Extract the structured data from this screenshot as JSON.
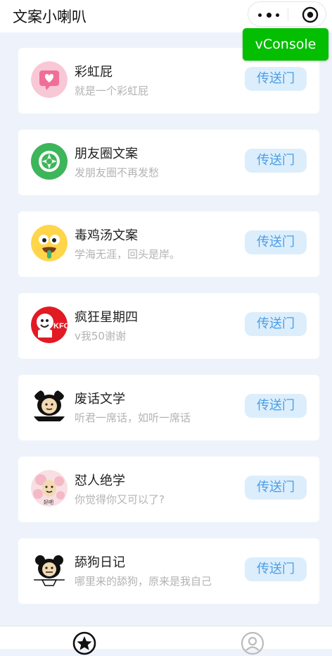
{
  "header": {
    "title": "文案小喇叭"
  },
  "capsule": {
    "more_icon": "more-dots-icon",
    "close_icon": "target-circle-icon"
  },
  "vconsole": {
    "label": "vConsole",
    "color": "#04be02"
  },
  "accent": {
    "button_bg": "#dceefc",
    "button_text": "#4a9de6",
    "background": "#eef3fb"
  },
  "cards": [
    {
      "title": "彩虹屁",
      "desc": "就是一个彩虹屁",
      "button": "传送门",
      "icon": "heart-chat-icon"
    },
    {
      "title": "朋友圈文案",
      "desc": "发朋友圈不再发愁",
      "button": "传送门",
      "icon": "moments-shutter-icon"
    },
    {
      "title": "毒鸡汤文案",
      "desc": "学海无涯，回头是岸。",
      "button": "传送门",
      "icon": "drooling-emoji-icon"
    },
    {
      "title": "疯狂星期四",
      "desc": "v我50谢谢",
      "button": "传送门",
      "icon": "kfc-logo-icon"
    },
    {
      "title": "废话文学",
      "desc": "听君一席话，如听一席话",
      "button": "传送门",
      "icon": "panda-meme-icon"
    },
    {
      "title": "怼人绝学",
      "desc": "你觉得你又可以了?",
      "button": "传送门",
      "icon": "pink-meme-icon"
    },
    {
      "title": "舔狗日记",
      "desc": "哪里来的舔狗，原来是我自己",
      "button": "传送门",
      "icon": "panda-head-meme-icon"
    }
  ],
  "avatar_labels": {
    "kfc": "KFC",
    "pink": "好吧"
  },
  "tabbar": {
    "tabs": [
      {
        "icon": "star-circle-icon"
      },
      {
        "icon": "user-circle-icon"
      }
    ]
  }
}
